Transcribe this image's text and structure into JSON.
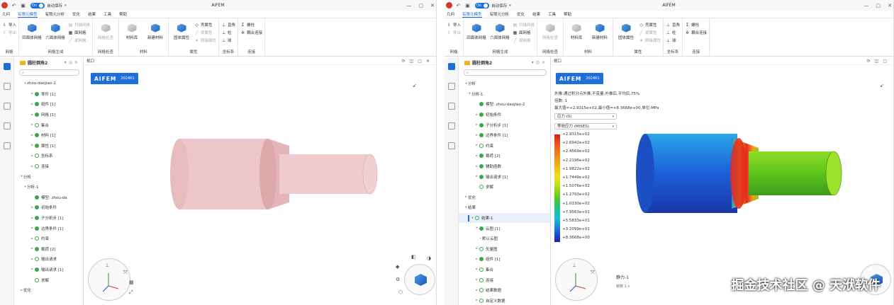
{
  "app": {
    "title": "AIFEM",
    "autosave_toggle": "On",
    "autosave_label": "自动保存"
  },
  "menu": {
    "items": [
      "几何",
      "有限元模型",
      "有限元分析",
      "优化",
      "结果",
      "工具",
      "帮助"
    ],
    "active": "有限元模型"
  },
  "ribbon": {
    "import": "导入",
    "export": "导出",
    "mesh_group": "网格",
    "tetra": "四面体网格",
    "hexa": "六面体网格",
    "auto_mesh": "扫描网格",
    "face_mesh": "面网格",
    "line_mesh": "梁网格",
    "mesh_gen": "网格生成",
    "mesh_check": "网格检查",
    "mesh_check_group": "网格检查",
    "material_lib": "材料库",
    "new_material": "新建材料",
    "material_group": "材料",
    "solid_prop": "固体属性",
    "shell_prop": "壳属性",
    "beam_prop": "梁属性",
    "plate_prop": "刚接属性",
    "prop_group": "属性",
    "rect": "直角",
    "cyl": "柱",
    "sph": "球",
    "coord_group": "坐标系",
    "bolt": "螺栓",
    "couple": "耦合连接",
    "connect_group": "连接"
  },
  "tree": {
    "header": "圆柱倒角2",
    "search_placeholder": "",
    "left_nodes": [
      {
        "label": "zhou-daojiao-2",
        "indent": 1,
        "toggle": "▾",
        "icon": "none"
      },
      {
        "label": "零件 [1]",
        "indent": 3,
        "toggle": "▸",
        "icon": "ok"
      },
      {
        "label": "组件 [1]",
        "indent": 3,
        "toggle": "▸",
        "icon": "ok"
      },
      {
        "label": "网格 [1]",
        "indent": 3,
        "toggle": "▸",
        "icon": "ok"
      },
      {
        "label": "集合",
        "indent": 3,
        "toggle": "▸",
        "icon": "ring"
      },
      {
        "label": "材料 [1]",
        "indent": 3,
        "toggle": "▸",
        "icon": "ok"
      },
      {
        "label": "属性 [1]",
        "indent": 3,
        "toggle": "▸",
        "icon": "ok"
      },
      {
        "label": "坐标系",
        "indent": 3,
        "toggle": "▸",
        "icon": "ring"
      },
      {
        "label": "连接",
        "indent": 3,
        "toggle": "▸",
        "icon": "ring"
      },
      {
        "label": "分析",
        "indent": 0,
        "toggle": "▾",
        "icon": "none"
      },
      {
        "label": "分析-1",
        "indent": 1,
        "toggle": "▾",
        "icon": "none"
      },
      {
        "label": "模型:   zhou-da",
        "indent": 3,
        "toggle": "",
        "icon": "ok"
      },
      {
        "label": "初始条件",
        "indent": 3,
        "toggle": "▸",
        "icon": "ok"
      },
      {
        "label": "子分析步 [1]",
        "indent": 3,
        "toggle": "▸",
        "icon": "ok"
      },
      {
        "label": "边界条件 [1]",
        "indent": 3,
        "toggle": "▸",
        "icon": "ok"
      },
      {
        "label": "约束",
        "indent": 3,
        "toggle": "▸",
        "icon": "ring"
      },
      {
        "label": "载荷 [2]",
        "indent": 3,
        "toggle": "▸",
        "icon": "ok"
      },
      {
        "label": "输出请求",
        "indent": 3,
        "toggle": "▸",
        "icon": "ring"
      },
      {
        "label": "输出请求 [1]",
        "indent": 3,
        "toggle": "▸",
        "icon": "ok"
      },
      {
        "label": "求解",
        "indent": 3,
        "toggle": "",
        "icon": "ring"
      },
      {
        "label": "优化",
        "indent": 0,
        "toggle": "▸",
        "icon": "none"
      }
    ],
    "right_nodes": [
      {
        "label": "分析",
        "indent": 0,
        "toggle": "▾",
        "icon": "none"
      },
      {
        "label": "分析-1",
        "indent": 1,
        "toggle": "▾",
        "icon": "none"
      },
      {
        "label": "模型:   zhou-daojiao-2",
        "indent": 3,
        "toggle": "",
        "icon": "ok"
      },
      {
        "label": "初始条件",
        "indent": 3,
        "toggle": "▸",
        "icon": "ok"
      },
      {
        "label": "子分析步 [1]",
        "indent": 3,
        "toggle": "▸",
        "icon": "ok"
      },
      {
        "label": "边界条件 [1]",
        "indent": 3,
        "toggle": "▸",
        "icon": "ok"
      },
      {
        "label": "约束",
        "indent": 3,
        "toggle": "▸",
        "icon": "ring"
      },
      {
        "label": "载荷 [2]",
        "indent": 3,
        "toggle": "▸",
        "icon": "ok"
      },
      {
        "label": "辅助函数",
        "indent": 3,
        "toggle": "▸",
        "icon": "ok"
      },
      {
        "label": "输出请求 [1]",
        "indent": 3,
        "toggle": "▸",
        "icon": "ok"
      },
      {
        "label": "求解",
        "indent": 3,
        "toggle": "",
        "icon": "ring"
      },
      {
        "label": "优化",
        "indent": 0,
        "toggle": "▸",
        "icon": "none"
      },
      {
        "label": "结果",
        "indent": 0,
        "toggle": "▾",
        "icon": "none"
      },
      {
        "label": "结果-1",
        "indent": 1,
        "toggle": "▾",
        "icon": "ring",
        "selected": true
      },
      {
        "label": "云图 [1]",
        "indent": 3,
        "toggle": "▾",
        "icon": "ok"
      },
      {
        "label": "默认云图",
        "indent": 4,
        "toggle": "•",
        "icon": "none"
      },
      {
        "label": "矢量图",
        "indent": 3,
        "toggle": "▸",
        "icon": "ring"
      },
      {
        "label": "组件 [1]",
        "indent": 3,
        "toggle": "▸",
        "icon": "ok"
      },
      {
        "label": "集合",
        "indent": 3,
        "toggle": "▸",
        "icon": "ring"
      },
      {
        "label": "连接",
        "indent": 3,
        "toggle": "▸",
        "icon": "ring"
      },
      {
        "label": "结果数据",
        "indent": 3,
        "toggle": "▸",
        "icon": "ring"
      },
      {
        "label": "自定义数据",
        "indent": 3,
        "toggle": "▸",
        "icon": "ring"
      }
    ]
  },
  "viewport": {
    "title": "视口",
    "brand": "AIFEM",
    "version": "2024R1",
    "info1": "外推:通过积分点外推,不变量:外推后,平均后,75%",
    "info2": "倍数:   1",
    "info3": "最大值=+2.9315e+02,最小值=+8.3668e+00,单位:MPa",
    "select1": "应力 (S)",
    "select2": "等效应力 (MISES)",
    "legend": [
      "+2.9315e+02",
      "+2.6942e+02",
      "+2.4569e+02",
      "+2.2196e+02",
      "+1.9822e+02",
      "+1.7449e+02",
      "+1.5076e+02",
      "+1.2703e+02",
      "+1.0330e+02",
      "+7.9563e+01",
      "+5.5833e+01",
      "+3.2099e+01",
      "+8.3668e+00"
    ],
    "step_label": "静力-1",
    "step_sub": "帧数 1 s",
    "watermark": "掘金技术社区 @ 天洑软件"
  },
  "colors": {
    "accent": "#1c6fd8",
    "ok": "#3aa845",
    "model": "#ecc6c9"
  }
}
